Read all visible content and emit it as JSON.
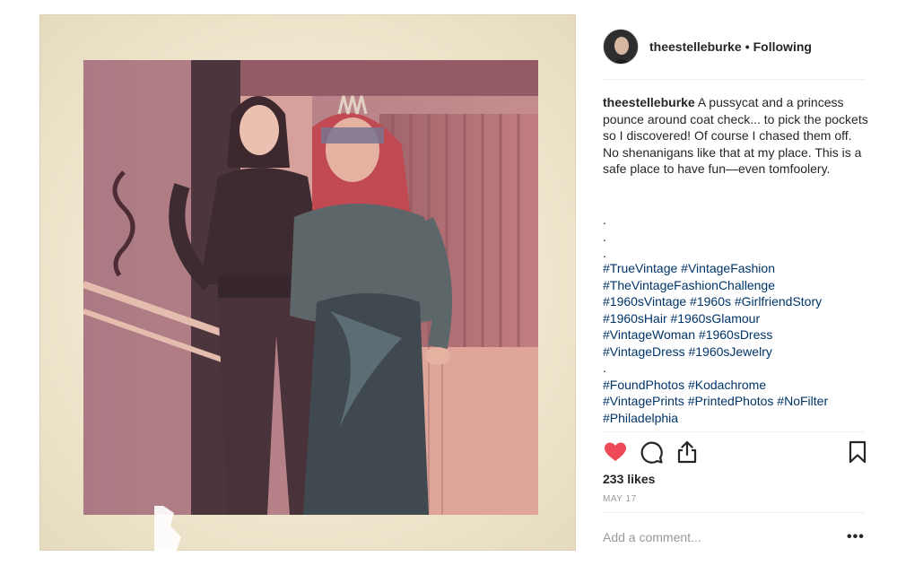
{
  "post": {
    "username": "theestelleburke",
    "separator": "•",
    "follow_status": "Following"
  },
  "caption": {
    "username": "theestelleburke",
    "text": "A pussycat and a princess pounce around coat check... to pick the pockets so I discovered! Of course I chased them off. No shenanigans like that at my place. This is a safe place to have fun—even tomfoolery.",
    "dots": [
      ".",
      ".",
      "."
    ]
  },
  "hashtags": [
    "#TrueVintage #VintageFashion",
    "#TheVintageFashionChallenge",
    "#1960sVintage #1960s #GirlfriendStory",
    "#1960sHair #1960sGlamour",
    "#VintageWoman #1960sDress",
    "#VintageDress #1960sJewelry",
    ".",
    "#FoundPhotos #Kodachrome",
    "#VintagePrints #PrintedPhotos #NoFilter",
    "#Philadelphia"
  ],
  "icons": {
    "like": "heart-icon",
    "comment": "comment-icon",
    "share": "share-icon",
    "save": "bookmark-icon",
    "more": "more-options-icon"
  },
  "colors": {
    "heart": "#ed4956",
    "hashtag": "#003569",
    "text": "#262626",
    "muted": "#999999"
  },
  "likes": "233 likes",
  "date": "MAY 17",
  "comment_input": {
    "placeholder": "Add a comment...",
    "value": ""
  },
  "more_label": "•••"
}
